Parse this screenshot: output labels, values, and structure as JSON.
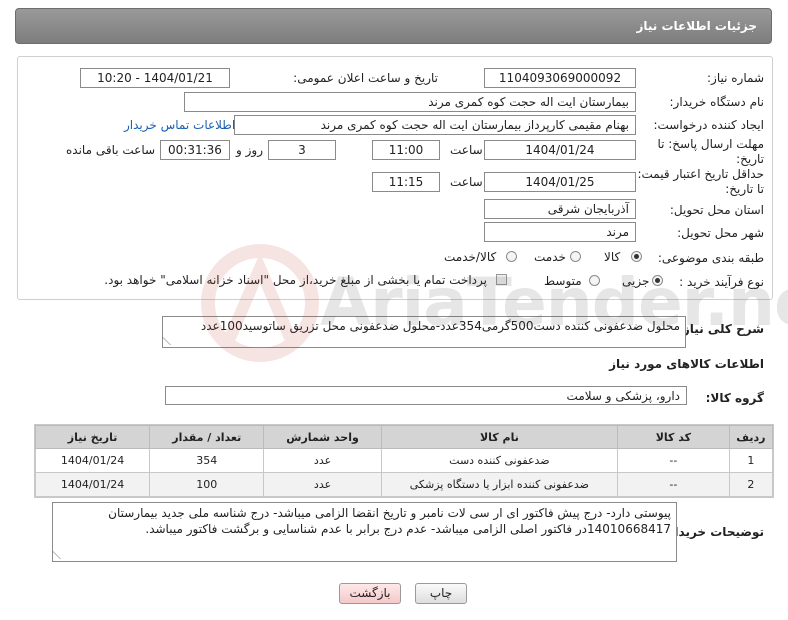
{
  "window": {
    "title": "جزئیات اطلاعات نیاز"
  },
  "form": {
    "need_number_label": "شماره نیاز:",
    "need_number": "1104093069000092",
    "announce_label": "تاریخ و ساعت اعلان عمومی:",
    "announce_value": "1404/01/21 - 10:20",
    "buyer_org_label": "نام دستگاه خریدار:",
    "buyer_org": "بیمارستان ایت اله حجت کوه کمری مرند",
    "creator_label": "ایجاد کننده درخواست:",
    "creator": "بهنام مقیمی کارپرداز بیمارستان ایت اله حجت کوه کمری مرند",
    "contact_link": "اطلاعات تماس خریدار",
    "reply_deadline_label": "مهلت ارسال پاسخ: تا تاریخ:",
    "reply_date": "1404/01/24",
    "time_label": "ساعت",
    "reply_time": "11:00",
    "days_value": "3",
    "days_label": "روز و",
    "remaining_time": "00:31:36",
    "remaining_label": "ساعت باقی مانده",
    "price_validity_label": "حداقل تاریخ اعتبار قیمت: تا تاریخ:",
    "price_date": "1404/01/25",
    "price_time": "11:15",
    "province_label": "استان محل تحویل:",
    "province": "آذربایجان شرقی",
    "city_label": "شهر محل تحویل:",
    "city": "مرند",
    "category_label": "طبقه بندی موضوعی:",
    "category_options": [
      "کالا",
      "خدمت",
      "کالا/خدمت"
    ],
    "category_selected": "کالا",
    "process_label": "نوع فرآیند خرید :",
    "process_options": [
      "جزیی",
      "متوسط"
    ],
    "process_selected": "جزیی",
    "payment_note": "پرداخت تمام یا بخشی از مبلغ خرید،از محل \"اسناد خزانه اسلامی\" خواهد بود."
  },
  "summary": {
    "label": "شرح کلی نیاز:",
    "text": "محلول ضدعفونی کننده دست500گرمی354عدد-محلول ضدعفونی محل تزریق ساتوسید100عدد"
  },
  "goods": {
    "section_title": "اطلاعات کالاهای مورد نیاز",
    "group_label": "گروه کالا:",
    "group_value": "دارو، پزشکی و سلامت",
    "columns": [
      "ردیف",
      "کد کالا",
      "نام کالا",
      "واحد شمارش",
      "تعداد / مقدار",
      "تاریخ نیاز"
    ],
    "rows": [
      {
        "idx": "1",
        "code": "--",
        "name": "ضدعفونی کننده دست",
        "unit": "عدد",
        "qty": "354",
        "date": "1404/01/24"
      },
      {
        "idx": "2",
        "code": "--",
        "name": "ضدعفونی کننده ابزار یا دستگاه پزشکی",
        "unit": "عدد",
        "qty": "100",
        "date": "1404/01/24"
      }
    ]
  },
  "buyer_notes": {
    "label": "توضیحات خریدار:",
    "line1": "پیوستی دارد- درج پیش فاکتور ای ار سی لات نامبر و تاریخ انقضا الزامی میباشد- درج شناسه ملی  جدید بیمارستان",
    "line2": "14010668417در فاکتور اصلی الزامی میباشد- عدم درج برابر با عدم شناسایی و برگشت فاکتور میباشد."
  },
  "buttons": {
    "print": "چاپ",
    "back": "بازگشت"
  },
  "watermark": {
    "text": "AriaTender.net"
  },
  "colors": {
    "titlebar": "#8a8a8a",
    "link": "#1a5fb4",
    "table_header": "#d4d4d4"
  }
}
